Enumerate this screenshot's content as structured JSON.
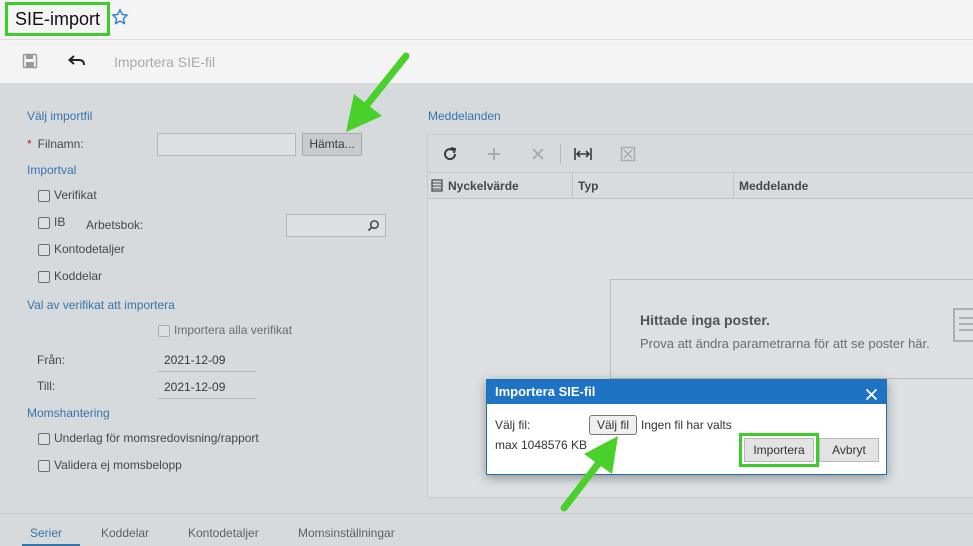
{
  "header": {
    "title": "SIE-import"
  },
  "toolbar": {
    "action_label": "Importera SIE-fil"
  },
  "form": {
    "section_file": "Välj importfil",
    "filename_label": "Filnamn:",
    "fetch_button": "Hämta...",
    "section_importval": "Importval",
    "verifikat": "Verifikat",
    "ib": "IB",
    "arbetsbok_label": "Arbetsbok:",
    "kontodetaljer": "Kontodetaljer",
    "koddelar": "Koddelar",
    "section_val": "Val av verifikat att importera",
    "import_all": "Importera alla verifikat",
    "fran_label": "Från:",
    "fran_value": "2021-12-09",
    "till_label": "Till:",
    "till_value": "2021-12-09",
    "section_moms": "Momshantering",
    "underlag": "Underlag för momsredovisning/rapport",
    "validera": "Validera ej momsbelopp"
  },
  "messages": {
    "title": "Meddelanden",
    "columns": [
      "Nyckelvärde",
      "Typ",
      "Meddelande"
    ],
    "empty_title": "Hittade inga poster.",
    "empty_text": "Prova att ändra parametrarna för att se poster här."
  },
  "tabs": [
    "Serier",
    "Koddelar",
    "Kontodetaljer",
    "Momsinställningar"
  ],
  "dialog": {
    "title": "Importera SIE-fil",
    "file_label": "Välj fil:",
    "choose_button": "Välj fil",
    "no_file": "Ingen fil har valts",
    "max_size": "max 1048576 KB",
    "import_button": "Importera",
    "cancel_button": "Avbryt"
  },
  "colors": {
    "accent": "#1f73c4",
    "highlight": "#3ccd2a"
  }
}
